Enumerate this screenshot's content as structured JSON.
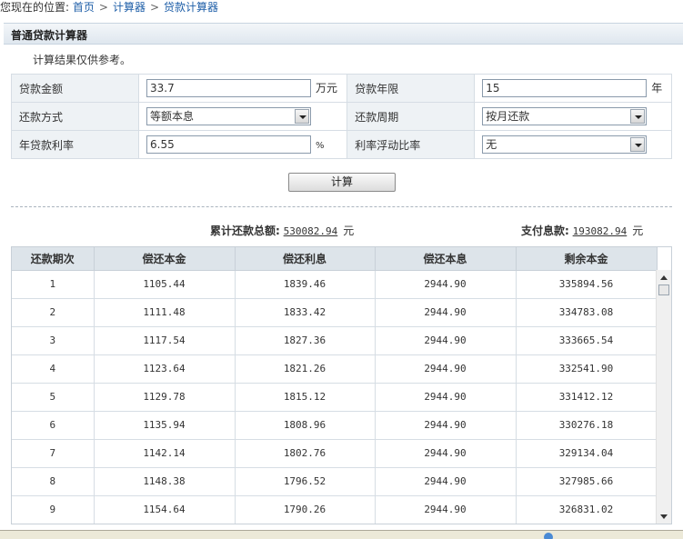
{
  "breadcrumb": {
    "prefix": "您现在的位置:",
    "items": [
      "首页",
      "计算器",
      "贷款计算器"
    ],
    "separator": ">"
  },
  "panel": {
    "title": "普通贷款计算器",
    "note": "计算结果仅供参考。"
  },
  "form": {
    "loan_amount_label": "贷款金额",
    "loan_amount_value": "33.7",
    "loan_amount_unit": "万元",
    "loan_years_label": "贷款年限",
    "loan_years_value": "15",
    "loan_years_unit": "年",
    "repay_method_label": "还款方式",
    "repay_method_value": "等额本息",
    "repay_period_label": "还款周期",
    "repay_period_value": "按月还款",
    "annual_rate_label": "年贷款利率",
    "annual_rate_value": "6.55",
    "annual_rate_unit": "%",
    "float_ratio_label": "利率浮动比率",
    "float_ratio_value": "无"
  },
  "calc_button": "计算",
  "summary": {
    "total_label": "累计还款总额:",
    "total_value": "530082.94",
    "interest_label": "支付息款:",
    "interest_value": "193082.94",
    "currency": "元"
  },
  "grid": {
    "headers": [
      "还款期次",
      "偿还本金",
      "偿还利息",
      "偿还本息",
      "剩余本金"
    ],
    "rows": [
      [
        "1",
        "1105.44",
        "1839.46",
        "2944.90",
        "335894.56"
      ],
      [
        "2",
        "1111.48",
        "1833.42",
        "2944.90",
        "334783.08"
      ],
      [
        "3",
        "1117.54",
        "1827.36",
        "2944.90",
        "333665.54"
      ],
      [
        "4",
        "1123.64",
        "1821.26",
        "2944.90",
        "332541.90"
      ],
      [
        "5",
        "1129.78",
        "1815.12",
        "2944.90",
        "331412.12"
      ],
      [
        "6",
        "1135.94",
        "1808.96",
        "2944.90",
        "330276.18"
      ],
      [
        "7",
        "1142.14",
        "1802.76",
        "2944.90",
        "329134.04"
      ],
      [
        "8",
        "1148.38",
        "1796.52",
        "2944.90",
        "327985.66"
      ],
      [
        "9",
        "1154.64",
        "1790.26",
        "2944.90",
        "326831.02"
      ]
    ]
  }
}
